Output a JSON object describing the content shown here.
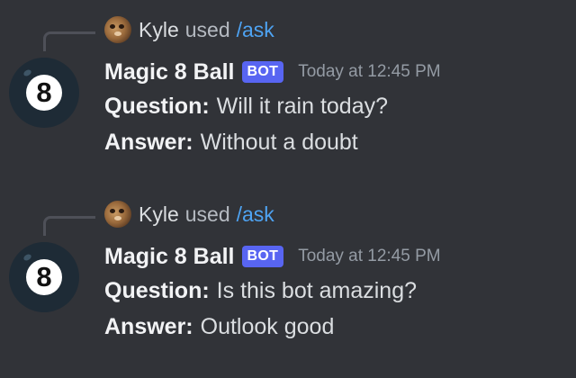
{
  "messages": [
    {
      "interaction": {
        "user": "Kyle",
        "used_text": "used",
        "command": "/ask"
      },
      "author": {
        "name": "Magic 8 Ball",
        "tag": "BOT",
        "avatar_glyph": "8"
      },
      "timestamp": "Today at 12:45 PM",
      "question_label": "Question:",
      "question": "Will it rain today?",
      "answer_label": "Answer:",
      "answer": "Without a doubt"
    },
    {
      "interaction": {
        "user": "Kyle",
        "used_text": "used",
        "command": "/ask"
      },
      "author": {
        "name": "Magic 8 Ball",
        "tag": "BOT",
        "avatar_glyph": "8"
      },
      "timestamp": "Today at 12:45 PM",
      "question_label": "Question:",
      "question": "Is this bot amazing?",
      "answer_label": "Answer:",
      "answer": "Outlook good"
    }
  ],
  "colors": {
    "background": "#313338",
    "bot_tag": "#5865f2",
    "command_link": "#4ea3f2",
    "avatar_bg": "#1e2b36"
  },
  "icons": {
    "user_avatar": "cat-avatar-icon",
    "bot_avatar": "magic-8-ball-icon"
  }
}
